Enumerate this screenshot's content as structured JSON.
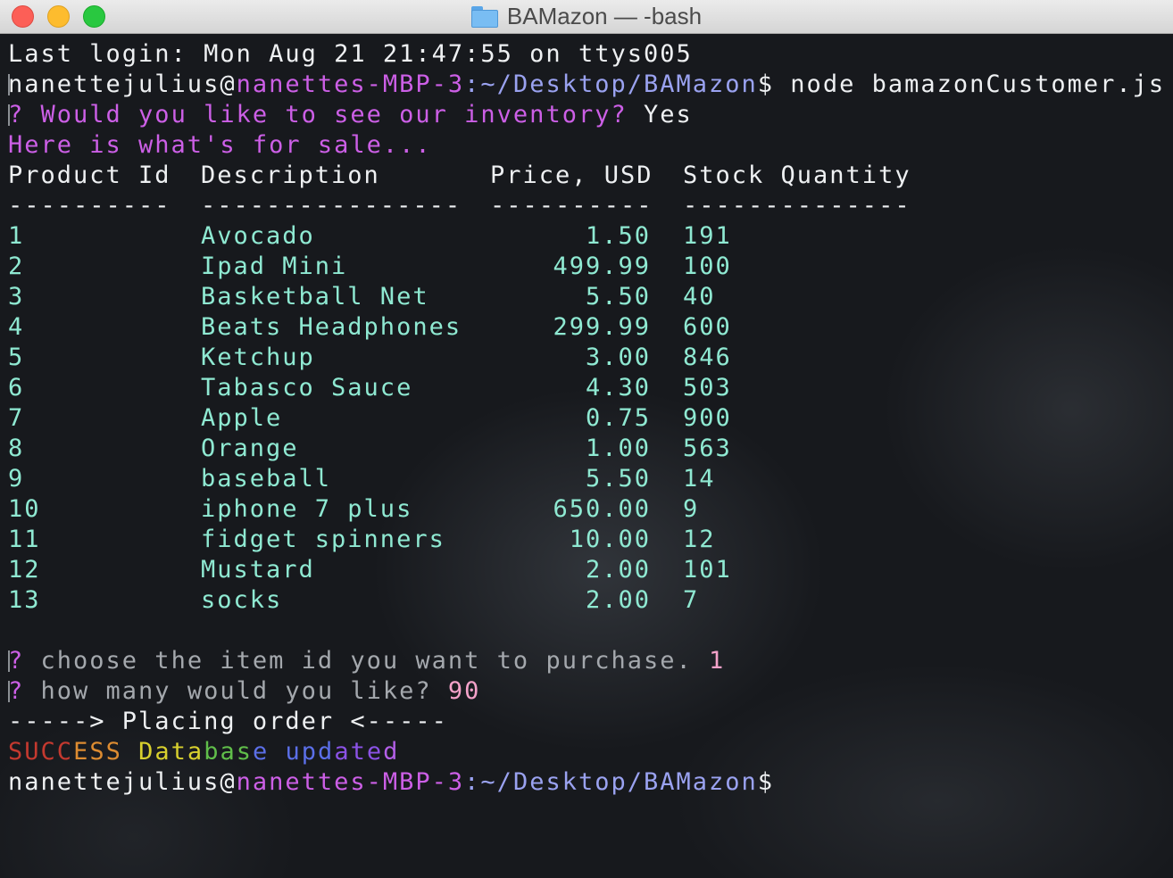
{
  "window": {
    "title": "BAMazon — -bash",
    "folder_icon": "folder-icon",
    "controls": [
      "close-button",
      "minimize-button",
      "zoom-button"
    ]
  },
  "terminal": {
    "last_login": "Last login: Mon Aug 21 21:47:55 on ttys005",
    "prompt_user": "nanettejulius",
    "prompt_at": "@",
    "prompt_host": "nanettes-MBP-3",
    "prompt_path": ":~/Desktop/BAMazon",
    "prompt_dollar": "$",
    "command": " node bamazonCustomer.js",
    "question1_mark": "?",
    "question1_text": " Would you like to see our inventory?",
    "question1_answer": " Yes",
    "sale_notice": "Here is what's for sale...",
    "table": {
      "columns": [
        "Product Id",
        "Description",
        "Price, USD",
        "Stock Quantity"
      ],
      "separators": [
        "----------",
        "----------------",
        "----------",
        "--------------"
      ],
      "rows": [
        {
          "id": "1",
          "description": "Avocado",
          "price": "1.50",
          "stock": "191"
        },
        {
          "id": "2",
          "description": "Ipad Mini",
          "price": "499.99",
          "stock": "100"
        },
        {
          "id": "3",
          "description": "Basketball Net",
          "price": "5.50",
          "stock": "40"
        },
        {
          "id": "4",
          "description": "Beats Headphones",
          "price": "299.99",
          "stock": "600"
        },
        {
          "id": "5",
          "description": "Ketchup",
          "price": "3.00",
          "stock": "846"
        },
        {
          "id": "6",
          "description": "Tabasco Sauce",
          "price": "4.30",
          "stock": "503"
        },
        {
          "id": "7",
          "description": "Apple",
          "price": "0.75",
          "stock": "900"
        },
        {
          "id": "8",
          "description": "Orange",
          "price": "1.00",
          "stock": "563"
        },
        {
          "id": "9",
          "description": "baseball",
          "price": "5.50",
          "stock": "14"
        },
        {
          "id": "10",
          "description": "iphone 7 plus",
          "price": "650.00",
          "stock": "9"
        },
        {
          "id": "11",
          "description": "fidget spinners",
          "price": "10.00",
          "stock": "12"
        },
        {
          "id": "12",
          "description": "Mustard",
          "price": "2.00",
          "stock": "101"
        },
        {
          "id": "13",
          "description": "socks",
          "price": "2.00",
          "stock": "7"
        }
      ]
    },
    "question2_mark": "?",
    "question2_text": " choose the item id you want to purchase.",
    "question2_answer": " 1",
    "question3_mark": "?",
    "question3_text": " how many would you like?",
    "question3_answer": " 90",
    "placing_order": "-----> Placing order <-----",
    "success_message": "SUCCESS Database updated",
    "success_colors": [
      "#c4392f",
      "#dd8c31",
      "#d8d02e",
      "#60be4a",
      "#5b6fe8",
      "#8b52e6",
      "#b35fe8"
    ]
  },
  "colors": {
    "prompt_host": "#cc5fe6",
    "prompt_path": "#9aa2f0",
    "table_text": "#8fe9d2",
    "question_mark": "#cc5fe6"
  }
}
